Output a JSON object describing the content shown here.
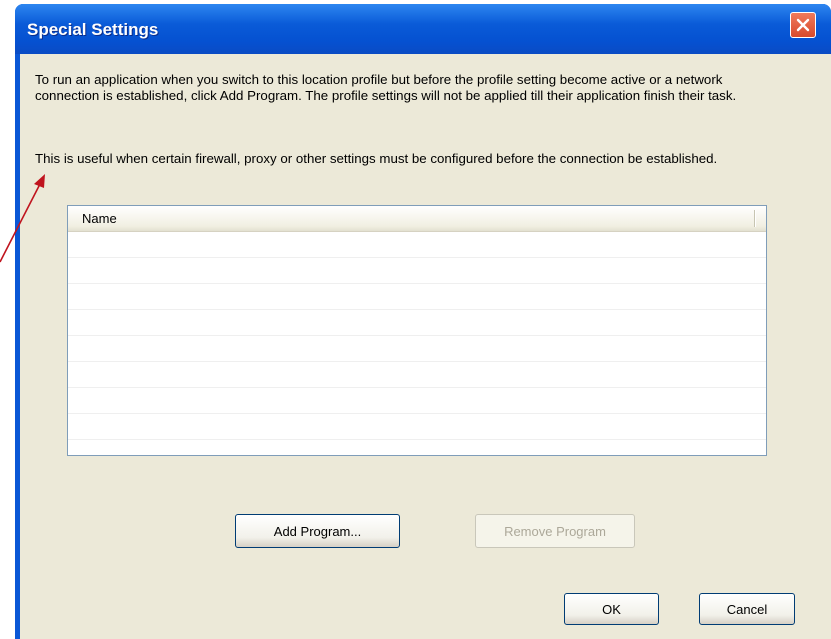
{
  "window": {
    "title": "Special Settings"
  },
  "content": {
    "description_1": "To run an application when you switch to this location profile but before the profile setting become active or a network connection is established, click Add Program. The profile settings will not be applied till their application finish their task.",
    "description_2": "This is useful when certain firewall, proxy or other settings must be configured before the connection be established."
  },
  "program_list": {
    "columns": [
      "Name"
    ],
    "rows": []
  },
  "buttons": {
    "add_program": "Add Program...",
    "remove_program": "Remove Program",
    "ok": "OK",
    "cancel": "Cancel"
  },
  "colors": {
    "annotation_arrow": "#c0141e",
    "titlebar": "#0a5bd8",
    "dialog_face": "#ece9d8"
  },
  "icons": {
    "close": "close-icon",
    "annotation": "annotation-arrow"
  }
}
